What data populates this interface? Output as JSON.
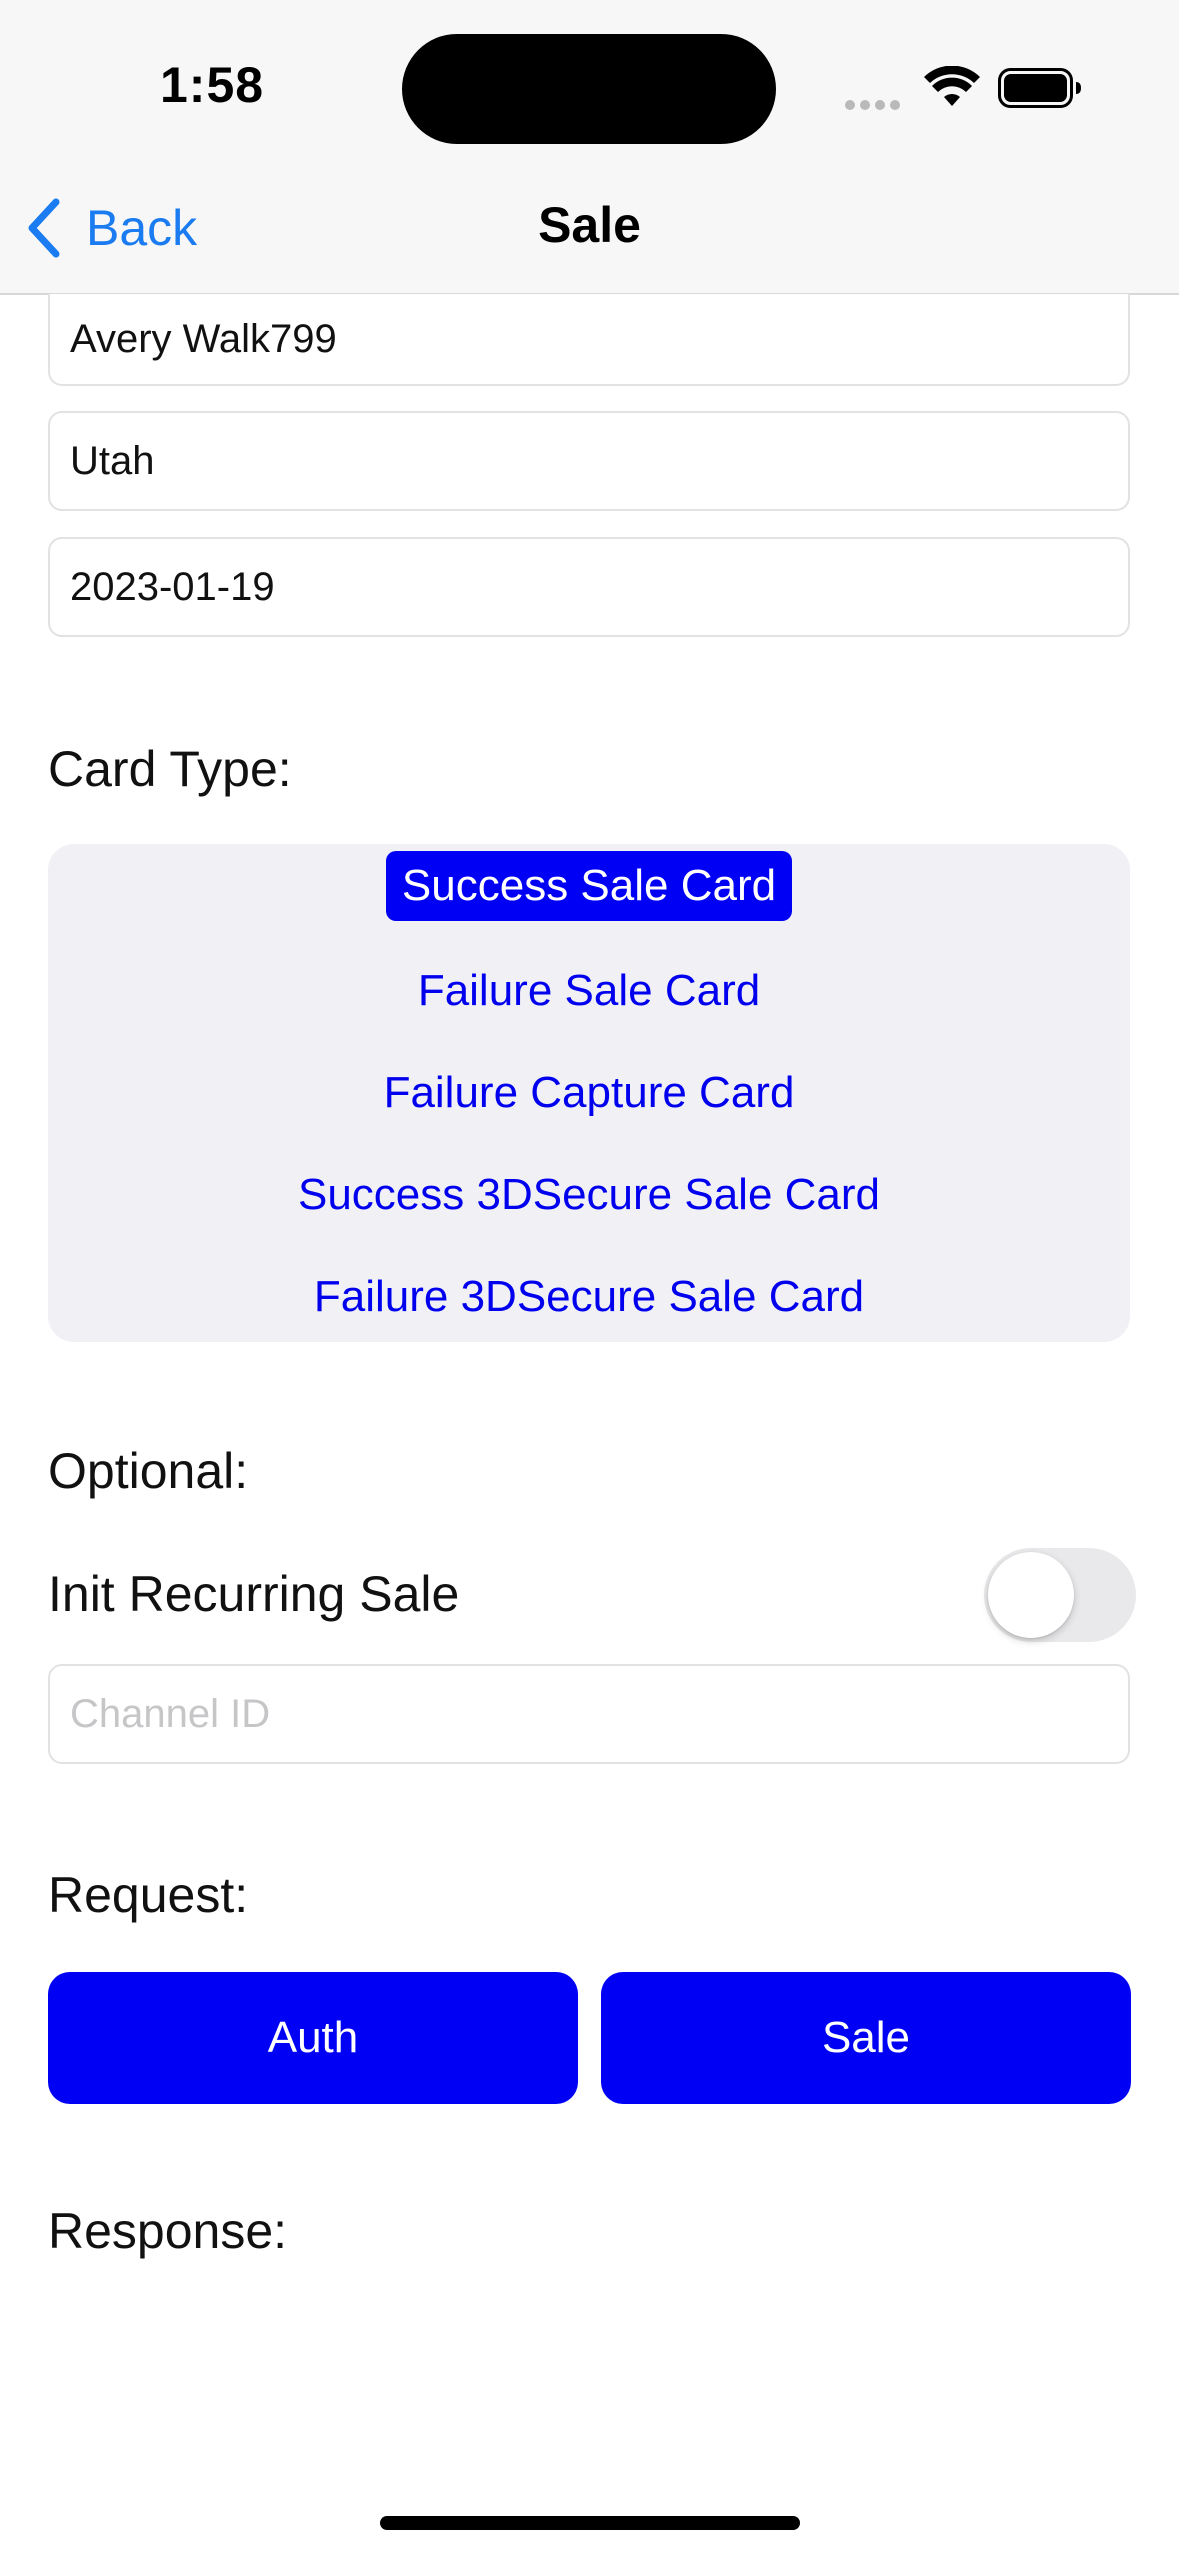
{
  "status_bar": {
    "time": "1:58"
  },
  "nav": {
    "back_label": "Back",
    "title": "Sale"
  },
  "fields": {
    "name_value": "Avery Walk799",
    "state_value": "Utah",
    "date_value": "2023-01-19"
  },
  "card_type": {
    "label": "Card Type:",
    "options": [
      "Success Sale Card",
      "Failure Sale Card",
      "Failure Capture Card",
      "Success 3DSecure Sale Card",
      "Failure 3DSecure Sale Card"
    ],
    "selected": "Success Sale Card"
  },
  "optional": {
    "label": "Optional:",
    "recurring_label": "Init Recurring Sale",
    "recurring_on": false,
    "channel_placeholder": "Channel ID"
  },
  "request": {
    "label": "Request:",
    "auth_label": "Auth",
    "sale_label": "Sale"
  },
  "response": {
    "label": "Response:"
  },
  "colors": {
    "accent_blue": "#1a7cf0",
    "button_blue": "#0000f5",
    "picker_bg": "#f0f0f5"
  }
}
